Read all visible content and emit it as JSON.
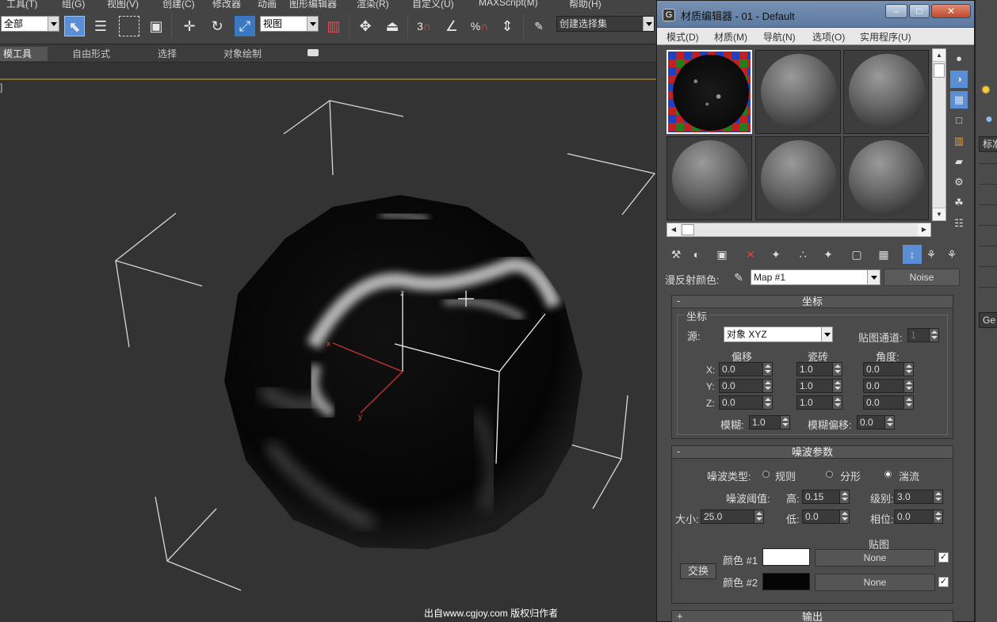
{
  "menubar": {
    "items": [
      "工具(T)",
      "组(G)",
      "视图(V)",
      "创建(C)",
      "修改器",
      "动画",
      "图形编辑器",
      "渲染(R)",
      "自定义(U)",
      "MAXScript(M)",
      "帮助(H)"
    ]
  },
  "toolbar": {
    "selection_filter": "全部",
    "ref_coord": "视图",
    "named_selection": "创建选择集",
    "icons": [
      "select-object-icon",
      "select-by-name-icon",
      "rect-region-icon",
      "window-crossing-icon",
      "move-icon",
      "rotate-icon",
      "scale-icon",
      "pivot-icon",
      "mirror-icon",
      "align-icon",
      "snap-3-icon",
      "angle-snap-icon",
      "percent-snap-icon",
      "spinner-snap-icon",
      "edit-named-selection-icon"
    ],
    "snap_label": "3",
    "percent_label": "%"
  },
  "ribbon": {
    "tabs": [
      "模工具",
      "自由形式",
      "选择",
      "对象绘制"
    ]
  },
  "viewport": {
    "label": "]",
    "watermark": "出自www.cgjoy.com 版权归作者",
    "axis_x": "x",
    "axis_y": "y",
    "axis_z": "z"
  },
  "material_editor": {
    "title": "材质编辑器 - 01 - Default",
    "app_icon": "G",
    "menu": [
      "模式(D)",
      "材质(M)",
      "导航(N)",
      "选项(O)",
      "实用程序(U)"
    ],
    "map_row": {
      "label": "漫反射颜色:",
      "map_name": "Map #1",
      "map_type": "Noise"
    },
    "coords": {
      "header": "坐标",
      "group_title": "坐标",
      "source_label": "源:",
      "source_value": "对象 XYZ",
      "map_channel_label": "贴图通道:",
      "map_channel": "1",
      "offset_label": "偏移",
      "tiling_label": "瓷砖",
      "angle_label": "角度:",
      "axes": [
        "X:",
        "Y:",
        "Z:"
      ],
      "offset": [
        "0.0",
        "0.0",
        "0.0"
      ],
      "tiling": [
        "1.0",
        "1.0",
        "1.0"
      ],
      "angle": [
        "0.0",
        "0.0",
        "0.0"
      ],
      "blur_label": "模糊:",
      "blur": "1.0",
      "blur_offset_label": "模糊偏移:",
      "blur_offset": "0.0"
    },
    "noise": {
      "header": "噪波参数",
      "type_label": "噪波类型:",
      "types": [
        "规则",
        "分形",
        "湍流"
      ],
      "selected_type": "湍流",
      "threshold_label": "噪波阈值:",
      "high_label": "高:",
      "high": "0.15",
      "levels_label": "级别:",
      "levels": "3.0",
      "size_label": "大小:",
      "size": "25.0",
      "low_label": "低:",
      "low": "0.0",
      "phase_label": "相位:",
      "phase": "0.0",
      "maps_label": "贴图",
      "swap_label": "交换",
      "color1_label": "颜色 #1",
      "color2_label": "颜色 #2",
      "color1": "#ffffff",
      "color2": "#050505",
      "map1": "None",
      "map2": "None",
      "map1_enabled": "✓",
      "map2_enabled": "✓"
    },
    "output": {
      "header": "输出"
    }
  },
  "command_panel": {
    "field1": "标准",
    "field2": "Ge"
  }
}
